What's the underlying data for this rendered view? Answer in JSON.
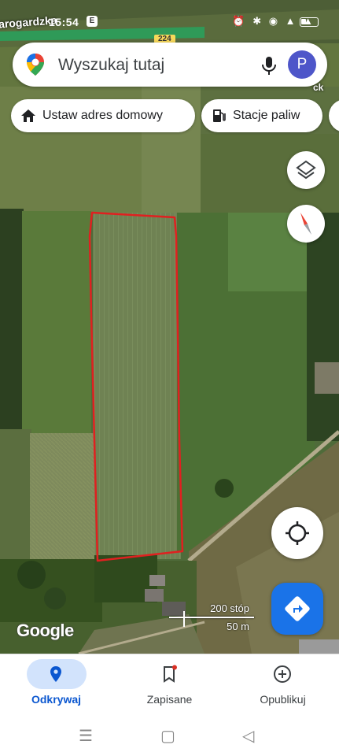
{
  "status_bar": {
    "time": "15:54",
    "badge": "E",
    "icons": [
      "alarm-icon",
      "bluetooth-icon",
      "location-icon",
      "volte-icon",
      "signal-icon",
      "signal-icon",
      "battery-icon"
    ]
  },
  "map": {
    "road_label_top": "arogardzka",
    "road_label_right": "ck",
    "road_number": "224",
    "parcel_outline_color": "#e02020"
  },
  "search": {
    "placeholder": "Wyszukaj tutaj",
    "avatar_letter": "P"
  },
  "chips": {
    "home": "Ustaw adres domowy",
    "fuel": "Stacje paliw"
  },
  "scale": {
    "imperial": "200 stóp",
    "metric": "50 m"
  },
  "attribution": "Google",
  "bottom_nav": {
    "explore": "Odkrywaj",
    "saved": "Zapisane",
    "publish": "Opublikuj"
  },
  "colors": {
    "accent": "#1a73e8",
    "active_nav": "#0b57d0",
    "avatar": "#4e56c9"
  }
}
